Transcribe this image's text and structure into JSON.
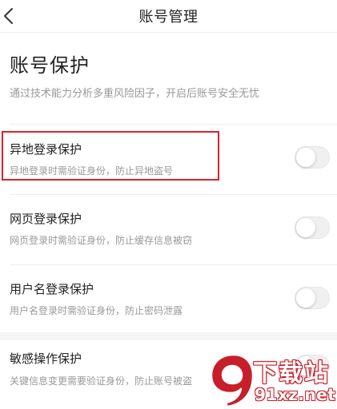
{
  "nav": {
    "title": "账号管理",
    "back_icon": "chevron-left-icon"
  },
  "section": {
    "title": "账号保护",
    "description": "通过技术能力分析多重风险因子，开启后账号安全无忧"
  },
  "settings": [
    {
      "title": "异地登录保护",
      "subtitle": "异地登录时需验证身份，防止异地盗号",
      "enabled": false,
      "highlighted": true
    },
    {
      "title": "网页登录保护",
      "subtitle": "网页登录时需验证身份，防止缓存信息被窃",
      "enabled": false,
      "highlighted": false
    },
    {
      "title": "用户名登录保护",
      "subtitle": "用户名登录时需验证身份，防止密码泄露",
      "enabled": false,
      "highlighted": false
    },
    {
      "title": "敏感操作保护",
      "subtitle": "关键信息变更需要验证身份，防止账号被盗",
      "enabled": false,
      "highlighted": false
    }
  ],
  "watermark": {
    "line1": "下载站",
    "line2": "91xz.net"
  },
  "colors": {
    "highlight": "#d9232a",
    "watermark": "#c81e2a",
    "toggle_off": "#f0f0f0",
    "subtitle_text": "#999999"
  }
}
